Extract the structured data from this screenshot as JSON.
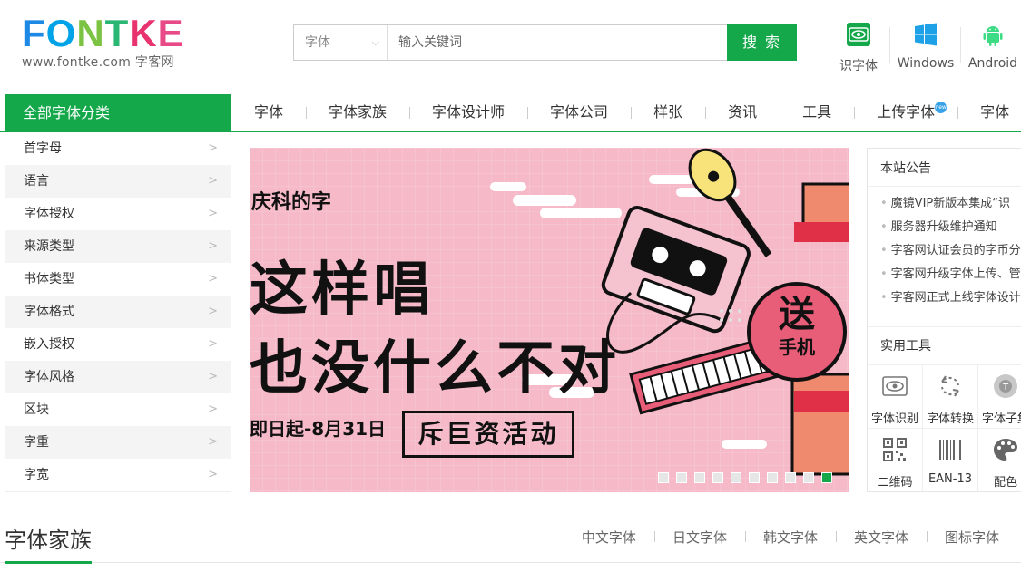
{
  "logo": {
    "word": [
      "F",
      "O",
      "N",
      "T",
      "K",
      "E"
    ],
    "subtitle": "www.fontke.com 字客网"
  },
  "search": {
    "type_label": "字体",
    "placeholder": "输入关键词",
    "button_label": "搜 索"
  },
  "header_tools": {
    "identify": "识字体",
    "windows": "Windows",
    "android": "Android"
  },
  "nav": {
    "all_categories": "全部字体分类",
    "items": [
      "字体",
      "字体家族",
      "字体设计师",
      "字体公司",
      "样张",
      "资讯",
      "工具",
      "上传字体",
      "字体"
    ],
    "new_badge": "new"
  },
  "sidebar": {
    "items": [
      "首字母",
      "语言",
      "字体授权",
      "来源类型",
      "书体类型",
      "字体格式",
      "嵌入授权",
      "字体风格",
      "区块",
      "字重",
      "字宽"
    ]
  },
  "banner": {
    "brand": "庆科的字",
    "line1": "这样唱",
    "line2": "也没什么不对",
    "date": "即日起-8月31日",
    "box_text": "斥巨资活动",
    "send_big": "送",
    "send_small": "手机",
    "slide_count": 10,
    "active_slide": 10
  },
  "announcements": {
    "title": "本站公告",
    "items": [
      "魔镜VIP新版本集成“识",
      "服务器升级维护通知",
      "字客网认证会员的字币分",
      "字客网升级字体上传、管",
      "字客网正式上线字体设计"
    ]
  },
  "tools": {
    "title": "实用工具",
    "items": [
      {
        "label": "字体识别",
        "icon": "eye-icon"
      },
      {
        "label": "字体转换",
        "icon": "convert-icon"
      },
      {
        "label": "字体子集",
        "icon": "subset-icon"
      },
      {
        "label": "二维码",
        "icon": "qrcode-icon"
      },
      {
        "label": "EAN-13",
        "icon": "barcode-icon"
      },
      {
        "label": "配色",
        "icon": "palette-icon"
      }
    ]
  },
  "family": {
    "title": "字体家族",
    "tabs": [
      "中文字体",
      "日文字体",
      "韩文字体",
      "英文字体",
      "图标字体"
    ]
  },
  "colors": {
    "brand_green": "#14a84b",
    "banner_pink": "#f5b9c8"
  }
}
